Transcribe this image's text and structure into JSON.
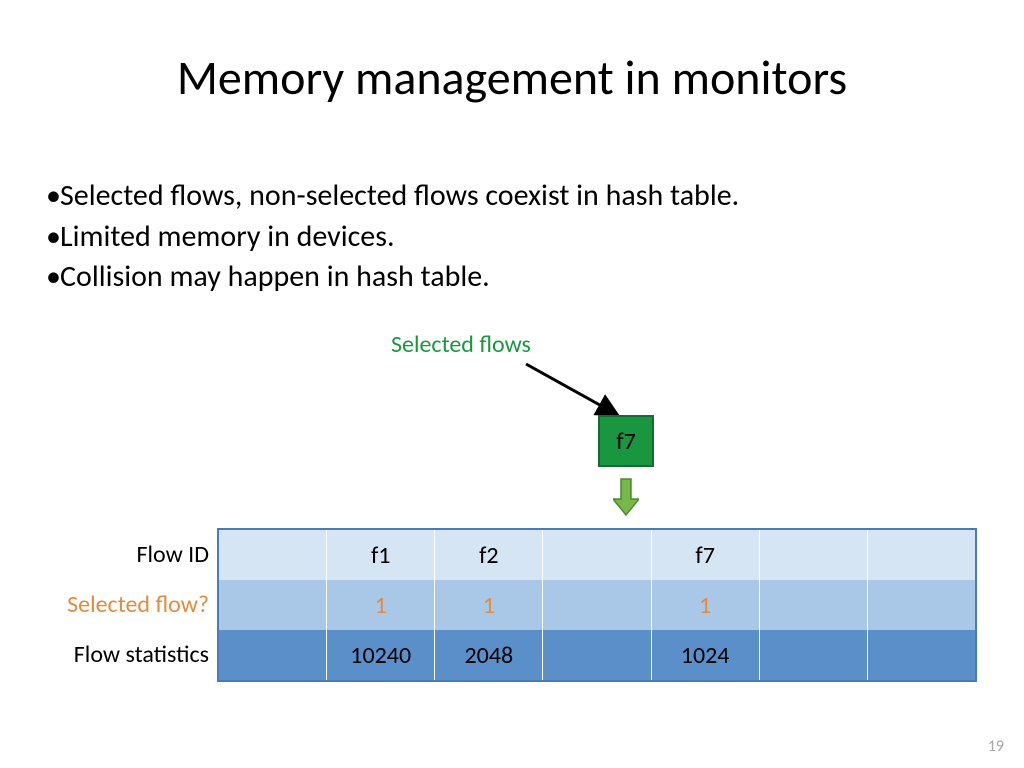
{
  "title": "Memory management in monitors",
  "bullets": [
    "Selected flows, non-selected flows coexist in hash table.",
    "Limited memory in devices.",
    "Collision may happen in hash table."
  ],
  "selected_flows_label": "Selected flows",
  "incoming_flow": "f7",
  "row_labels": {
    "flow_id": "Flow ID",
    "selected": "Selected flow?",
    "stats": "Flow statistics"
  },
  "columns": [
    {
      "flow_id": "",
      "selected": "",
      "stats": ""
    },
    {
      "flow_id": "f1",
      "selected": "1",
      "stats": "10240"
    },
    {
      "flow_id": "f2",
      "selected": "1",
      "stats": "2048"
    },
    {
      "flow_id": "",
      "selected": "",
      "stats": ""
    },
    {
      "flow_id": "f7",
      "selected": "1",
      "stats": "1024"
    },
    {
      "flow_id": "",
      "selected": "",
      "stats": ""
    },
    {
      "flow_id": "",
      "selected": "",
      "stats": ""
    }
  ],
  "page_number": "19"
}
